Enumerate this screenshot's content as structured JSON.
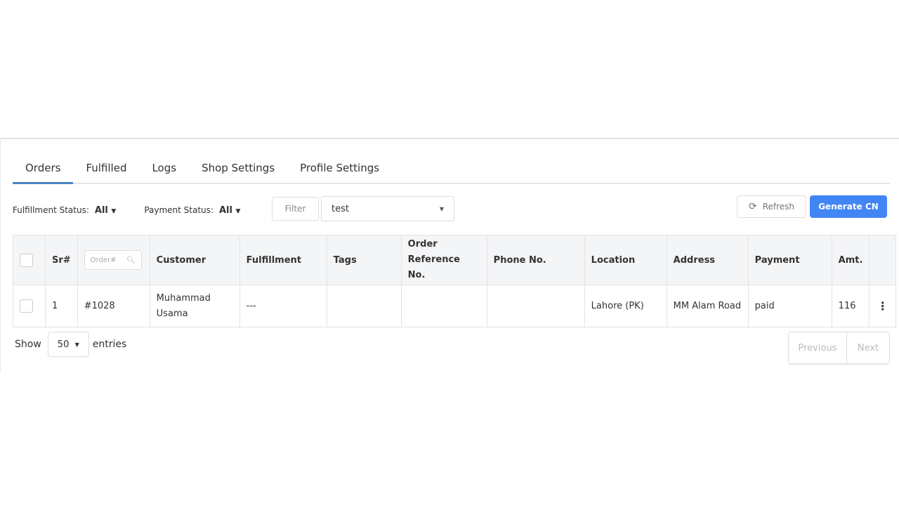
{
  "tabs": [
    "Orders",
    "Fulfilled",
    "Logs",
    "Shop Settings",
    "Profile Settings"
  ],
  "filters": {
    "fulfillment_label": "Fulfillment Status:",
    "fulfillment_value": "All",
    "payment_label": "Payment Status:",
    "payment_value": "All",
    "filter_button": "Filter",
    "select_value": "test"
  },
  "actions": {
    "refresh": "Refresh",
    "generate": "Generate CN",
    "generate_color": "#4285f4"
  },
  "table": {
    "search_placeholder": "Order#",
    "headers": [
      "Sr#",
      "Customer",
      "Fulfillment",
      "Tags",
      "Order Reference No.",
      "Phone No.",
      "Location",
      "Address",
      "Payment",
      "Amt."
    ],
    "rows": [
      {
        "sr": "1",
        "order": "#1028",
        "customer": "Muhammad Usama",
        "fulfillment": "---",
        "tags": "",
        "ref": "",
        "phone": "",
        "location": "Lahore (PK)",
        "address": "MM Alam Road",
        "payment": "paid",
        "amt": "116"
      }
    ]
  },
  "footer": {
    "show": "Show",
    "length": "50",
    "entries": "entries",
    "previous": "Previous",
    "next": "Next"
  }
}
